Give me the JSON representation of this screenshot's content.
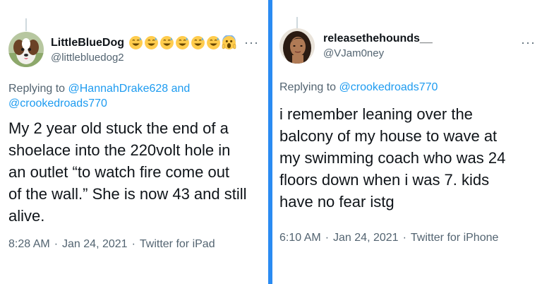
{
  "left_tweet": {
    "display_name": "LittleBlueDog",
    "name_emojis": [
      "grinning-sweat-emoji",
      "grinning-sweat-emoji",
      "grinning-sweat-emoji",
      "grinning-sweat-emoji",
      "grinning-sweat-emoji",
      "grinning-sweat-emoji",
      "screaming-fear-emoji"
    ],
    "handle": "@littlebluedog2",
    "more_label": "···",
    "replying_prefix": "Replying to",
    "replying_mention_1": "@HannahDrake628",
    "replying_and": "and",
    "replying_mention_2": "@crookedroads770",
    "text_lines": [
      "My 2 year old stuck the end of a",
      "shoelace into the 220volt hole in",
      "an outlet “to watch fire come out",
      "of the wall.” She is now 43 and still",
      "alive."
    ],
    "time": "8:28 AM",
    "date": "Jan 24, 2021",
    "source": "Twitter for iPad",
    "separator": "·"
  },
  "right_tweet": {
    "display_name": "releasethehounds__",
    "handle": "@VJam0ney",
    "more_label": "···",
    "replying_prefix": "Replying to",
    "replying_mention_1": "@crookedroads770",
    "text_lines": [
      "i remember leaning over the",
      "balcony of my house to wave at",
      "my swimming coach who was 24",
      "floors down when i was 7. kids",
      "have no fear istg"
    ],
    "time": "6:10 AM",
    "date": "Jan 24, 2021",
    "source": "Twitter for iPhone",
    "separator": "·"
  },
  "colors": {
    "divider": "#2a8bf2",
    "mention": "#1d9bf0",
    "secondary_text": "#536471",
    "primary_text": "#0f1419"
  }
}
